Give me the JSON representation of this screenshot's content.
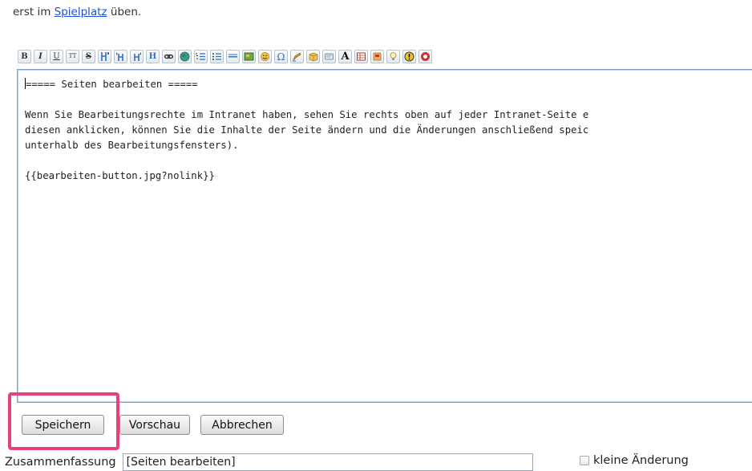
{
  "intro": {
    "prefix": "erst im ",
    "link": "Spielplatz",
    "suffix": " üben."
  },
  "toolbar": {
    "buttons": [
      {
        "name": "bold-button",
        "glyph": "B",
        "icon": "bold-icon"
      },
      {
        "name": "italic-button",
        "glyph": "I",
        "icon": "italic-icon"
      },
      {
        "name": "underline-button",
        "glyph": "U",
        "icon": "underline-icon"
      },
      {
        "name": "monospace-button",
        "glyph": "TT",
        "icon": "monospace-icon"
      },
      {
        "name": "strikethrough-button",
        "glyph": "S",
        "icon": "strikethrough-icon"
      },
      {
        "name": "heading-same-button",
        "glyph": "",
        "icon": "heading-same-icon"
      },
      {
        "name": "heading-lower-button",
        "glyph": "",
        "icon": "heading-lower-icon"
      },
      {
        "name": "heading-higher-button",
        "glyph": "",
        "icon": "heading-higher-icon"
      },
      {
        "name": "headings-menu-button",
        "glyph": "H",
        "icon": "heading-icon"
      },
      {
        "name": "link-button",
        "glyph": "",
        "icon": "link-icon"
      },
      {
        "name": "external-link-button",
        "glyph": "",
        "icon": "globe-icon"
      },
      {
        "name": "ordered-list-button",
        "glyph": "",
        "icon": "ordered-list-icon"
      },
      {
        "name": "unordered-list-button",
        "glyph": "",
        "icon": "unordered-list-icon"
      },
      {
        "name": "horizontal-rule-button",
        "glyph": "",
        "icon": "horizontal-rule-icon"
      },
      {
        "name": "add-image-button",
        "glyph": "",
        "icon": "image-icon"
      },
      {
        "name": "smileys-button",
        "glyph": "",
        "icon": "smiley-icon"
      },
      {
        "name": "special-chars-button",
        "glyph": "Ω",
        "icon": "omega-icon"
      },
      {
        "name": "signature-button",
        "glyph": "",
        "icon": "pen-icon"
      },
      {
        "name": "box-button",
        "glyph": "",
        "icon": "box-icon"
      },
      {
        "name": "note-button",
        "glyph": "",
        "icon": "note-icon"
      },
      {
        "name": "font-button",
        "glyph": "A",
        "icon": "font-icon"
      },
      {
        "name": "table-button",
        "glyph": "",
        "icon": "table-icon"
      },
      {
        "name": "wrap-button",
        "glyph": "",
        "icon": "wrap-icon"
      },
      {
        "name": "tip-button",
        "glyph": "",
        "icon": "lightbulb-icon"
      },
      {
        "name": "important-button",
        "glyph": "!",
        "icon": "warning-icon"
      },
      {
        "name": "stop-button",
        "glyph": "",
        "icon": "stop-icon"
      }
    ]
  },
  "editor": {
    "lines": [
      "===== Seiten bearbeiten =====",
      "",
      "Wenn Sie Bearbeitungsrechte im Intranet haben, sehen Sie rechts oben auf jeder Intranet-Seite e",
      "diesen anklicken, können Sie die Inhalte der Seite ändern und die Änderungen anschließend speic",
      "unterhalb des Bearbeitungsfensters).",
      "",
      "{{bearbeiten-button.jpg?nolink}}"
    ]
  },
  "buttons": {
    "save": "Speichern",
    "preview": "Vorschau",
    "cancel": "Abbrechen"
  },
  "summary": {
    "label": "Zusammenfassung",
    "value": "[Seiten bearbeiten]",
    "minor_label": "kleine Änderung"
  },
  "colors": {
    "highlight": "#e8417a",
    "link": "#1f4fd6",
    "editor_border": "#7aa6d6"
  }
}
